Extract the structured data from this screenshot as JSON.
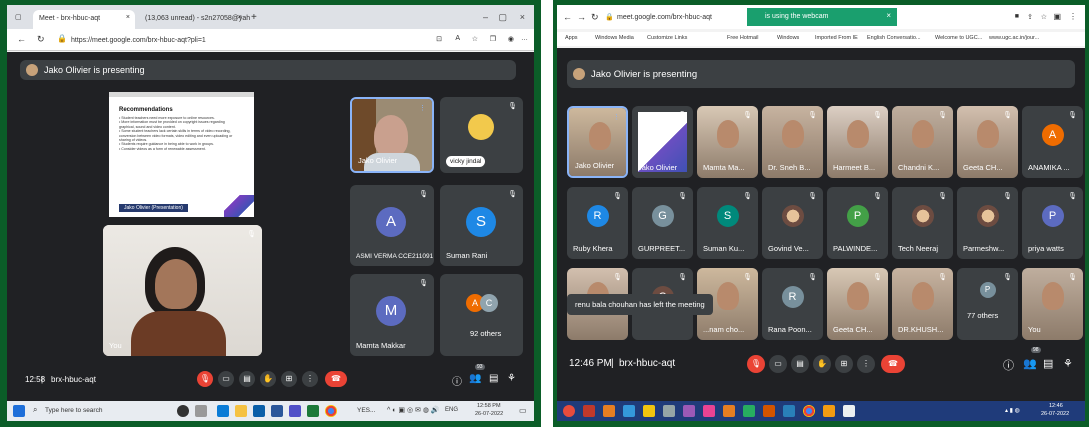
{
  "left": {
    "tabs": [
      {
        "label": "Meet - brx-hbuc-aqt",
        "close": "×"
      },
      {
        "label": "(13,063 unread) - s2n27058@yah",
        "close": "×"
      }
    ],
    "new_tab": "+",
    "window_controls": {
      "min": "–",
      "max": "▢",
      "close": "×"
    },
    "url": "https://meet.google.com/brx-hbuc-aqt?pli=1",
    "presenting": "Jako Olivier is presenting",
    "slide": {
      "title": "Recommendations",
      "bullets": [
        "• Student teachers need more exposure to online resources.",
        "• More information must be provided on copyright issues regarding graphical, sound and video content.",
        "• Some student teachers lack certain skills in terms of video recording, conversion between video formats, video editing and even uploading or sharing of videos.",
        "• Students require guidance in being able to work in groups.",
        "• Consider videos as a form of renewable assessment."
      ],
      "caption": "Jako Olivier (Presentation)"
    },
    "self_name": "You",
    "tiles": [
      {
        "name": "Jako Olivier"
      },
      {
        "name": "vicky jindal"
      },
      {
        "name": "ASMI VERMA CCE211091",
        "initial": "A"
      },
      {
        "name": "Suman Rani",
        "initial": "S"
      },
      {
        "name": "Mamta Makkar",
        "initial": "M"
      },
      {
        "name": "92 others",
        "initials": [
          "A",
          "C"
        ]
      }
    ],
    "time": "12:58",
    "meeting_code": "brx-hbuc-aqt",
    "participants_badge": "93",
    "taskbar": {
      "search_placeholder": "Type here to search",
      "tray_text": "YES...",
      "lang": "ENG",
      "clock_time": "12:58 PM",
      "clock_date": "26-07-2022"
    },
    "colors": {
      "avatar_a": "#5c6bc0",
      "avatar_s": "#1e88e5",
      "avatar_m": "#5c6bc0",
      "end_call": "#ea4335"
    }
  },
  "right": {
    "url": "meet.google.com/brx-hbuc-aqt",
    "webcam_notice": "is using the webcam",
    "bookmarks": [
      "Apps",
      "Windows Media",
      "Customize Links",
      "Free Hotmail",
      "Windows",
      "Imported From IE",
      "English Conversatio...",
      "Welcome to UGC...",
      "www.ugc.ac.in/jour..."
    ],
    "presenting": "Jako Olivier is presenting",
    "rows": [
      [
        {
          "name": "Jako Olivier",
          "kind": "video"
        },
        {
          "name": "Jako Olivier",
          "kind": "screen"
        },
        {
          "name": "Mamta Ma...",
          "kind": "video"
        },
        {
          "name": "Dr. Sneh B...",
          "kind": "video"
        },
        {
          "name": "Harmeet B...",
          "kind": "video"
        },
        {
          "name": "Chandni K...",
          "kind": "video"
        },
        {
          "name": "Geeta CH...",
          "kind": "video"
        },
        {
          "name": "ANAMIKA ...",
          "kind": "avatar",
          "initial": "A",
          "color": "#ef6c00"
        }
      ],
      [
        {
          "name": "Ruby Khera",
          "kind": "avatar",
          "initial": "R",
          "color": "#1e88e5"
        },
        {
          "name": "GURPREET...",
          "kind": "avatar",
          "initial": "G",
          "color": "#78909c"
        },
        {
          "name": "Suman Ku...",
          "kind": "avatar",
          "initial": "S",
          "color": "#00897b"
        },
        {
          "name": "Govind Ve...",
          "kind": "photo"
        },
        {
          "name": "PALWINDE...",
          "kind": "avatar",
          "initial": "P",
          "color": "#43a047"
        },
        {
          "name": "Tech Neeraj",
          "kind": "photo"
        },
        {
          "name": "Parmeshw...",
          "kind": "photo"
        },
        {
          "name": "priya watts",
          "kind": "avatar",
          "initial": "P",
          "color": "#5c6bc0"
        }
      ],
      [
        {
          "name": "",
          "kind": "video"
        },
        {
          "name": "",
          "kind": "avatar",
          "initial": "C",
          "color": "#6d4c41"
        },
        {
          "name": "...nam cho...",
          "kind": "video"
        },
        {
          "name": "Rana Poon...",
          "kind": "avatar",
          "initial": "R",
          "color": "#78909c"
        },
        {
          "name": "Geeta CH...",
          "kind": "video"
        },
        {
          "name": "DR.KHUSH...",
          "kind": "video"
        },
        {
          "name": "77 others",
          "kind": "others",
          "initial": "P"
        },
        {
          "name": "You",
          "kind": "video"
        }
      ]
    ],
    "toast": "renu bala chouhan has left the meeting",
    "time": "12:46 PM",
    "meeting_code": "brx-hbuc-aqt",
    "participants_badge": "98",
    "taskbar": {
      "clock_time": "12:46",
      "clock_date": "26-07-2022"
    }
  }
}
